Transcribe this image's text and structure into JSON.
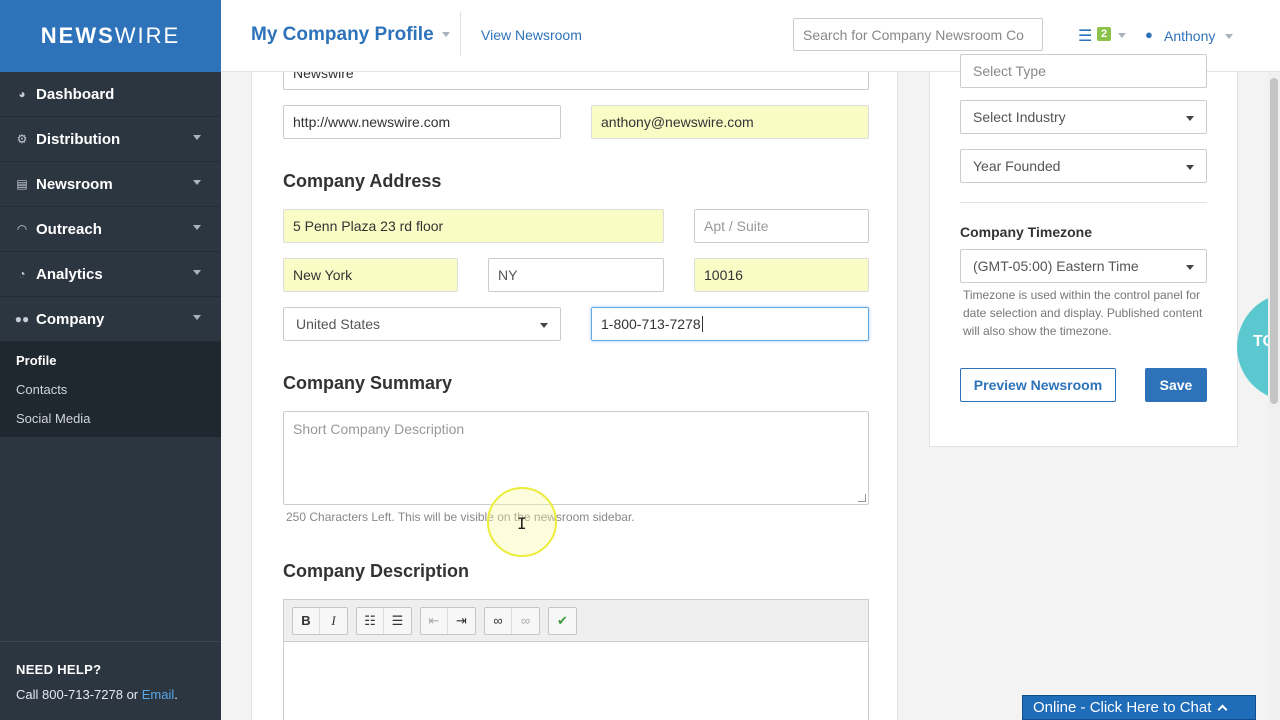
{
  "brand": {
    "logo_bold": "NEWS",
    "logo_light": "WIRE"
  },
  "sidebar": {
    "items": [
      {
        "label": "Dashboard",
        "icon": "dashboard-icon"
      },
      {
        "label": "Distribution",
        "icon": "distribution-icon"
      },
      {
        "label": "Newsroom",
        "icon": "newsroom-icon"
      },
      {
        "label": "Outreach",
        "icon": "rss-icon"
      },
      {
        "label": "Analytics",
        "icon": "pie-chart-icon"
      },
      {
        "label": "Company",
        "icon": "users-icon"
      }
    ],
    "subitems": [
      "Profile",
      "Contacts",
      "Social Media"
    ],
    "help_title": "NEED HELP?",
    "help_text": "Call 800-713-7278 or ",
    "help_link": "Email",
    "help_tail": "."
  },
  "header": {
    "title": "My Company Profile",
    "view_link": "View Newsroom",
    "search_placeholder": "Search for Company Newsroom Co",
    "badge_count": "2",
    "user": "Anthony"
  },
  "form": {
    "company_name": "Newswire",
    "website": "http://www.newswire.com",
    "email": "anthony@newswire.com",
    "address_heading": "Company Address",
    "street": "5 Penn Plaza 23 rd floor",
    "apt_placeholder": "Apt / Suite",
    "city": "New York",
    "state": "NY",
    "zip": "10016",
    "country": "United States",
    "phone": "1-800-713-7278",
    "summary_heading": "Company Summary",
    "summary_placeholder": "Short Company Description",
    "summary_hint": "250 Characters Left. This will be visible on the newsroom sidebar.",
    "description_heading": "Company Description"
  },
  "right_panel": {
    "type_select": "Select Type",
    "industry_select": "Select Industry",
    "year_select": "Year Founded",
    "timezone_label": "Company Timezone",
    "timezone_value": "(GMT-05:00) Eastern Time",
    "timezone_help": "Timezone is used within the control panel for date selection and display. Published content will also show the timezone.",
    "preview_button": "Preview Newsroom",
    "save_button": "Save"
  },
  "chat": {
    "label": "Online - Click Here to Chat"
  },
  "bubble": {
    "text": "TO"
  }
}
